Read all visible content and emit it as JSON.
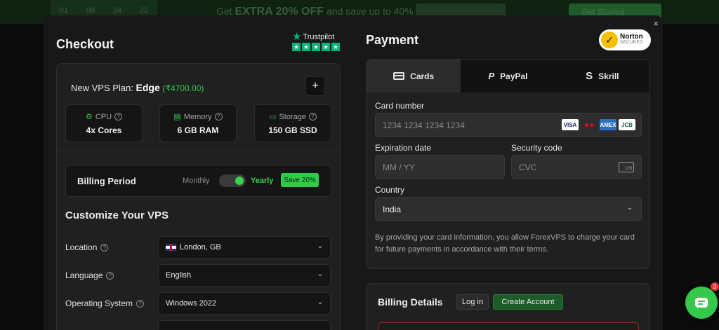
{
  "promo": {
    "timer": [
      "01",
      "08",
      "24",
      "22"
    ],
    "text_prefix": "Get",
    "text_bold": "EXTRA 20% OFF",
    "text_suffix": "and save up to 40%",
    "cta_label": "Get Started"
  },
  "checkout": {
    "title": "Checkout",
    "trustpilot": {
      "label": "Trustpilot",
      "stars": 5
    },
    "plan": {
      "prefix": "New VPS Plan:",
      "name": "Edge",
      "price": "(₹4700.00)",
      "add_icon": "+"
    },
    "specs": [
      {
        "label": "CPU",
        "value": "4x Cores",
        "icon": "cpu-icon"
      },
      {
        "label": "Memory",
        "value": "6 GB RAM",
        "icon": "memory-icon"
      },
      {
        "label": "Storage",
        "value": "150 GB SSD",
        "icon": "storage-icon"
      }
    ],
    "billing": {
      "label": "Billing Period",
      "monthly": "Monthly",
      "yearly": "Yearly",
      "save": "Save 20%",
      "yearly_selected": true
    },
    "customize_title": "Customize Your VPS",
    "fields": [
      {
        "label": "Location",
        "value": "London, GB"
      },
      {
        "label": "Language",
        "value": "English"
      },
      {
        "label": "Operating System",
        "value": "Windows 2022"
      }
    ]
  },
  "payment": {
    "title": "Payment",
    "norton": {
      "name": "Norton",
      "sub": "SECURED"
    },
    "tabs": [
      "Cards",
      "PayPal",
      "Skrill"
    ],
    "active_tab": "Cards",
    "card_number_label": "Card number",
    "card_number_placeholder": "1234 1234 1234 1234",
    "card_logos": [
      "VISA",
      "●●",
      "AMEX",
      "JCB"
    ],
    "expiry_label": "Expiration date",
    "expiry_placeholder": "MM / YY",
    "cvc_label": "Security code",
    "cvc_placeholder": "CVC",
    "cvc_icon_text": "123",
    "country_label": "Country",
    "country_value": "India",
    "disclaimer": "By providing your card information, you allow ForexVPS to charge your card for future payments in accordance with their terms."
  },
  "billing_details": {
    "title": "Billing Details",
    "login": "Log in",
    "create": "Create Account"
  },
  "chat": {
    "badge": "3"
  },
  "modal_close": "×",
  "colors": {
    "accent": "#35c84b",
    "background": "#181818",
    "panel": "#202020"
  }
}
